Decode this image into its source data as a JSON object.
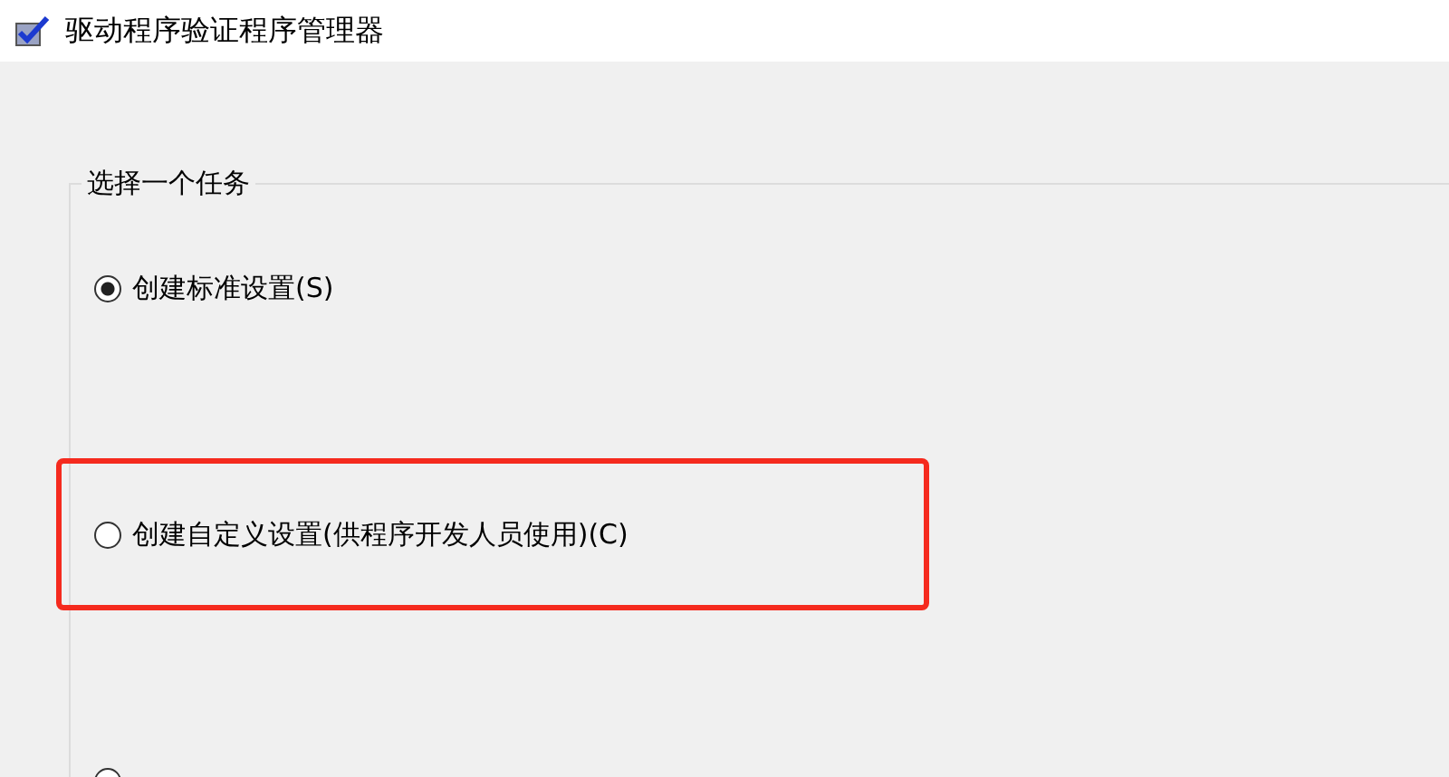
{
  "window": {
    "title": "驱动程序验证程序管理器"
  },
  "task_group": {
    "legend": "选择一个任务",
    "options": [
      {
        "label": "创建标准设置(S)",
        "selected": true,
        "highlighted": false
      },
      {
        "label": "创建自定义设置(供程序开发人员使用)(C)",
        "selected": false,
        "highlighted": true
      },
      {
        "selected": false,
        "highlighted": false
      }
    ]
  }
}
